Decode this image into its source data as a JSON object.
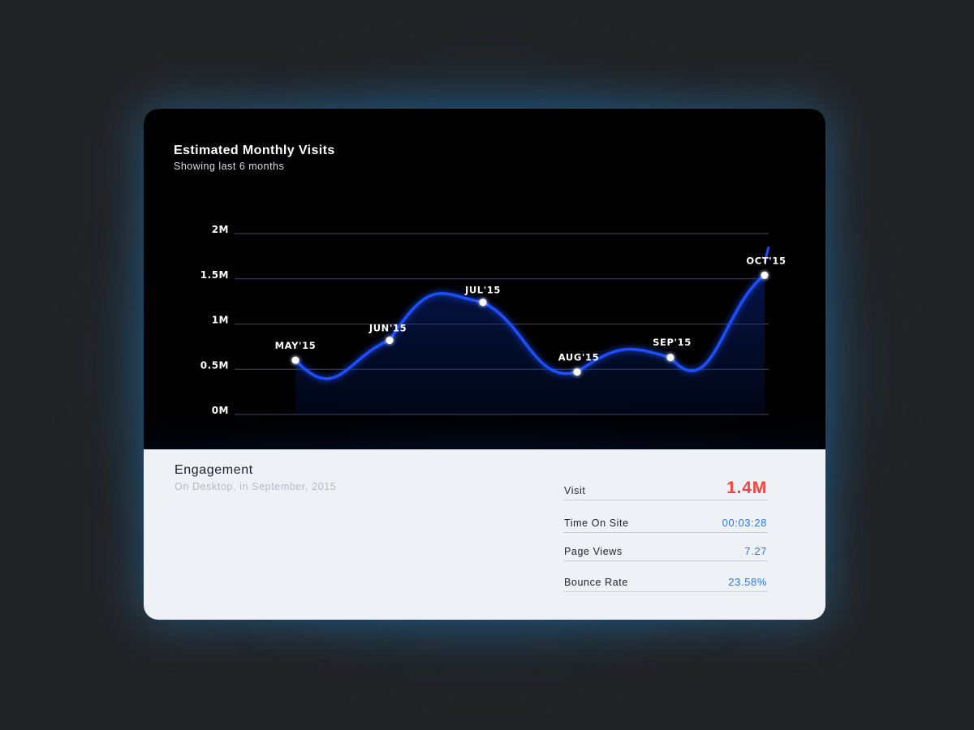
{
  "chart_data": {
    "type": "line",
    "title": "Estimated Monthly Visits",
    "subtitle": "Showing last 6 months",
    "categories": [
      "MAY'15",
      "JUN'15",
      "JUL'15",
      "AUG'15",
      "SEP'15",
      "OCT'15"
    ],
    "values": [
      0.6,
      0.82,
      1.24,
      0.47,
      0.63,
      1.54
    ],
    "yunit": "M",
    "yticks": [
      "2M",
      "1.5M",
      "1M",
      "0.5M",
      "0M"
    ],
    "ytick_values": [
      2,
      1.5,
      1,
      0.5,
      0
    ],
    "ylim": [
      0,
      2
    ],
    "grid": true,
    "line_color": "#1f4fff",
    "point_color": "#ffffff"
  },
  "engagement": {
    "title": "Engagement",
    "subtitle": "On Desktop, in September, 2015",
    "stats": [
      {
        "label": "Visit",
        "value": "1.4M"
      },
      {
        "label": "Time On Site",
        "value": "00:03:28"
      },
      {
        "label": "Page Views",
        "value": "7.27"
      },
      {
        "label": "Bounce Rate",
        "value": "23.58%"
      }
    ],
    "highlight_color": "#f2453f",
    "value_color": "#2f78e8"
  }
}
